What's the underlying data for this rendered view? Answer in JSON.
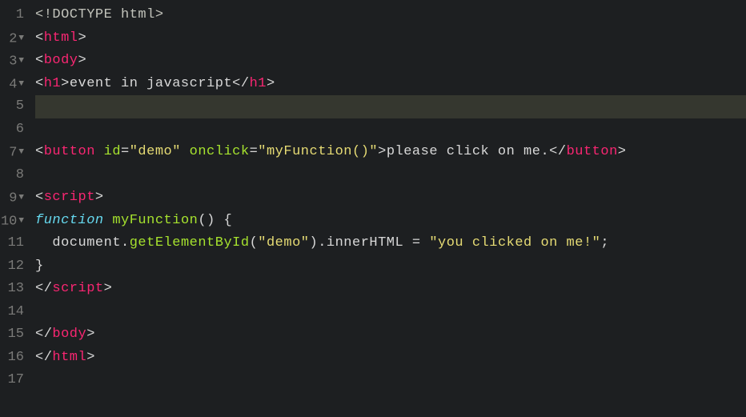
{
  "lines": [
    {
      "num": "1",
      "foldable": false
    },
    {
      "num": "2",
      "foldable": true
    },
    {
      "num": "3",
      "foldable": true
    },
    {
      "num": "4",
      "foldable": true
    },
    {
      "num": "5",
      "foldable": false,
      "highlighted": true
    },
    {
      "num": "6",
      "foldable": false
    },
    {
      "num": "7",
      "foldable": true
    },
    {
      "num": "8",
      "foldable": false
    },
    {
      "num": "9",
      "foldable": true
    },
    {
      "num": "10",
      "foldable": true
    },
    {
      "num": "11",
      "foldable": false
    },
    {
      "num": "12",
      "foldable": false
    },
    {
      "num": "13",
      "foldable": false
    },
    {
      "num": "14",
      "foldable": false
    },
    {
      "num": "15",
      "foldable": false
    },
    {
      "num": "16",
      "foldable": false
    },
    {
      "num": "17",
      "foldable": false
    }
  ],
  "tokens": {
    "doctype": "<!DOCTYPE html>",
    "lt": "<",
    "gt": ">",
    "ltslash": "</",
    "html": "html",
    "body": "body",
    "h1": "h1",
    "h1_text": "event in javascript",
    "button": "button",
    "id_attr": "id",
    "eq": "=",
    "demo_val": "\"demo\"",
    "onclick_attr": "onclick",
    "onclick_val": "\"myFunction()\"",
    "button_text": "please click on me.",
    "script": "script",
    "function_kw": "function",
    "func_name": "myFunction",
    "lparen": "(",
    "rparen": ")",
    "space": " ",
    "lbrace": "{",
    "rbrace": "}",
    "document_ident": "document",
    "dot": ".",
    "getElementById": "getElementById",
    "demo_arg": "\"demo\"",
    "innerHTML": "innerHTML",
    "assign": " = ",
    "clicked_str": "\"you clicked on me!\"",
    "semi": ";",
    "indent2": "  ",
    "indent4": "    "
  }
}
